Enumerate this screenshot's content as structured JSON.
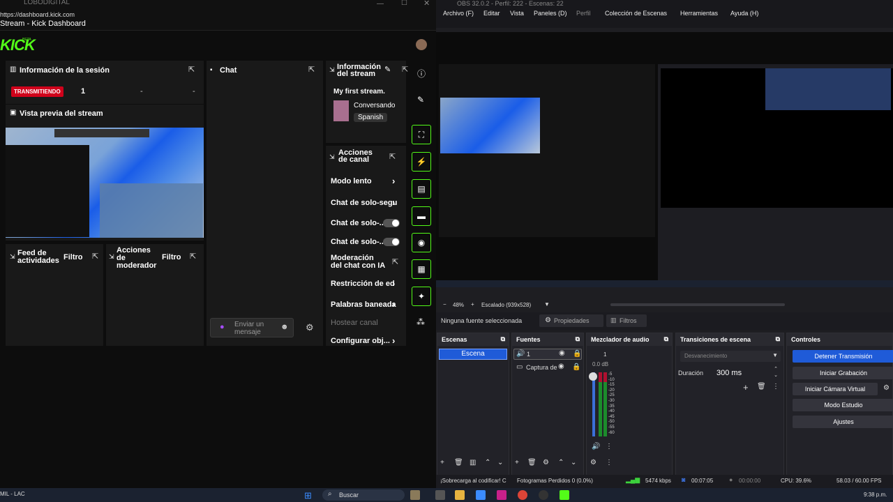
{
  "browser": {
    "tab": "LOBODIGITAL",
    "url": "https://dashboard.kick.com",
    "title": "Stream - Kick Dashboard",
    "logo": "KICK",
    "beta": "BETA"
  },
  "kick": {
    "session": {
      "title": "Información de la sesión",
      "status": "TRANSMITIENDO",
      "viewers": "1",
      "dash1": "-",
      "dash2": "-"
    },
    "preview": {
      "title": "Vista previa del stream"
    },
    "feed": {
      "title": "Feed de actividades",
      "filter": "Filtro"
    },
    "modactions": {
      "title": "Acciones de moderador",
      "filter": "Filtro"
    },
    "chat": {
      "title": "Chat",
      "placeholder": "Enviar un mensaje"
    },
    "info": {
      "title": "Información del stream",
      "stream_title": "My first stream.",
      "category": "Conversando",
      "language": "Spanish"
    },
    "channel": {
      "title": "Acciones de canal",
      "items": [
        "Modo lento",
        "Chat de solo-segu",
        "Chat de solo-...",
        "Chat de solo-...",
        "Moderación del chat con IA",
        "Restricción de ed",
        "Palabras baneada",
        "Hostear canal",
        "Configurar obj..."
      ]
    }
  },
  "obs": {
    "titlebar": "OBS 32.0.2 - Perfil: 222 - Escenas: 22",
    "menu": [
      "Archivo (F)",
      "Editar",
      "Vista",
      "Paneles (D)",
      "Perfil",
      "Colección de Escenas",
      "Herramientas",
      "Ayuda (H)"
    ],
    "zoom": "48%",
    "scaling": "Escalado (939x528)",
    "nosource": "Ninguna fuente seleccionada",
    "props": "Propiedades",
    "filters": "Filtros",
    "scenes": {
      "title": "Escenas",
      "items": [
        "Escena"
      ]
    },
    "sources": {
      "title": "Fuentes",
      "items": [
        "1",
        "Captura de"
      ]
    },
    "mixer": {
      "title": "Mezclador de audio",
      "channel": "1",
      "db": "0.0 dB",
      "ticks": [
        "-5",
        "-10",
        "-15",
        "-20",
        "-25",
        "-30",
        "-35",
        "-40",
        "-45",
        "-50",
        "-55",
        "-60"
      ]
    },
    "transitions": {
      "title": "Transiciones de escena",
      "type": "Desvanecimiento",
      "duration_label": "Duración",
      "duration": "300 ms"
    },
    "controls": {
      "title": "Controles",
      "stop": "Detener Transmisión",
      "record": "Iniciar Grabación",
      "vcam": "Iniciar Cámara Virtual",
      "studio": "Modo Estudio",
      "settings": "Ajustes"
    },
    "status": {
      "overload": "¡Sobrecarga al codificar! C",
      "dropped": "Fotogramas Perdidos 0 (0.0%)",
      "kbps": "5474 kbps",
      "stream_time": "00:07:05",
      "rec_time": "00:00:00",
      "cpu": "CPU: 39.6%",
      "fps": "58.03 / 60.00 FPS"
    }
  },
  "taskbar": {
    "left_label": "MIL - LAC",
    "search": "Buscar",
    "time": "9:38 p.m."
  },
  "colors": {
    "kick_green": "#53fc18",
    "live_red": "#d0021b",
    "obs_blue": "#1f5bd8"
  }
}
